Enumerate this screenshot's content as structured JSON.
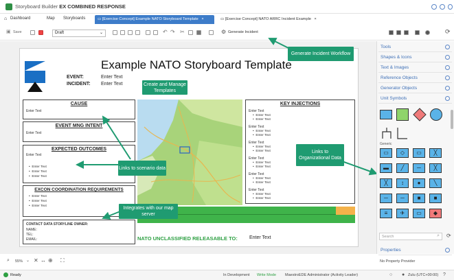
{
  "window": {
    "title_prefix": "Storyboard Builder",
    "title_doc": "EX COMBINED RESPONSE"
  },
  "nav": {
    "dashboard": "Dashboard",
    "map": "Map",
    "storyboards": "Storyboards",
    "tab1": "[Exercise Concept] Example NATO Storyboard Template",
    "tab2": "[Exercise Concept] NATO ARRC Incident Example"
  },
  "toolbar": {
    "save": "Save",
    "status_value": "Draft",
    "generate_incident": "Generate Incident"
  },
  "document": {
    "title": "Example NATO Storyboard Template",
    "event_label": "EVENT:",
    "event_value": "Enter Text",
    "incident_label": "INCIDENT:",
    "incident_value": "Enter Text",
    "cause_heading": "CAUSE",
    "cause_text": "Enter Text",
    "event_mng_heading": "EVENT MNG INTENT",
    "event_mng_text": "Enter Text",
    "expected_heading": "EXPECTED OUTCOMES",
    "expected_text": "Enter Text",
    "expected_bullets": [
      "Enter Text",
      "Enter Text",
      "Enter Text"
    ],
    "excon_heading": "EXCON COORDINATION REQUIREMENTS",
    "excon_bullets": [
      "Enter Text",
      "Enter Text",
      "Enter Text"
    ],
    "contact_heading": "CONTACT DATA STORYLINE OWNER:",
    "contact_name": "NAME:",
    "contact_tel": "TEL:",
    "contact_email": "EMAIL:",
    "key_injections_heading": "KEY INJECTIONS",
    "key_injections_text": "Enter Text",
    "key_injections_bullet": "Enter Text",
    "unclass_label": "NATO UNCLASSIFIED RELEASABLE TO:",
    "unclass_value": "Enter Text"
  },
  "callouts": {
    "generate_incident": "Generate Incident Workflow",
    "create_templates": "Create and Manage Templates",
    "links_scenario": "Links to scenario data",
    "links_org": "Links to Organizational Data",
    "map_server": "Integrates with our map server"
  },
  "panel": {
    "tools": "Tools",
    "shapes_icons": "Shapes & Icons",
    "text_images": "Text & Images",
    "reference_objects": "Reference Objects",
    "generator_objects": "Generator Objects",
    "unit_symbols": "Unit Symbols",
    "generic_label": "Generic",
    "search_placeholder": "Search",
    "properties": "Properties",
    "no_property": "No Property Provider"
  },
  "zoom": {
    "level": "55%"
  },
  "status": {
    "ready": "Ready",
    "dev": "In Development",
    "mode": "Write Mode",
    "user": "MaestroEDE Administrator (Activity Leader)",
    "timezone": "Zulu (UTC+00:00)"
  },
  "colors": {
    "accent_blue": "#3d7cc9",
    "callout_green": "#1f9b71",
    "map_green": "#9ccf6e",
    "bar_green": "#2ea043"
  }
}
